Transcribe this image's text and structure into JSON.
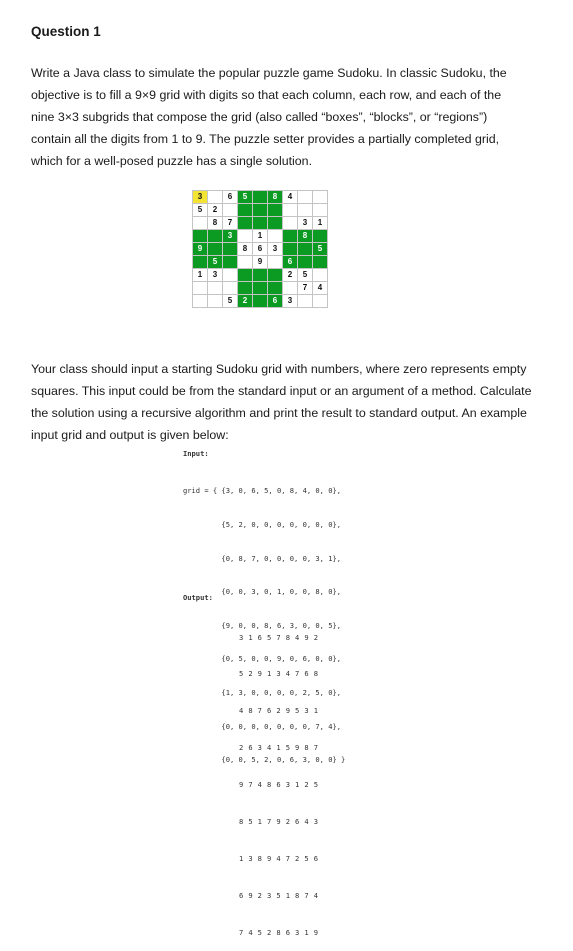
{
  "heading": "Question 1",
  "paragraph1": [
    "Write a Java class to simulate the popular puzzle game Sudoku. In classic Sudoku, the",
    "objective is to fill a 9×9 grid with digits so that each column, each row, and each of the",
    "nine 3×3 subgrids that compose the grid (also called “boxes”, “blocks”, or “regions”)",
    "contain all the digits from 1 to 9. The puzzle setter provides a partially completed grid,",
    "which for a well-posed puzzle has a single solution."
  ],
  "puzzle": [
    [
      "3",
      "",
      "6",
      "5",
      "",
      "8",
      "4",
      "",
      ""
    ],
    [
      "5",
      "2",
      "",
      "",
      "",
      "",
      "",
      "",
      ""
    ],
    [
      "",
      "8",
      "7",
      "",
      "",
      "",
      "",
      "3",
      "1"
    ],
    [
      "",
      "",
      "3",
      "",
      "1",
      "",
      "",
      "8",
      ""
    ],
    [
      "9",
      "",
      "",
      "8",
      "6",
      "3",
      "",
      "",
      "5"
    ],
    [
      "",
      "5",
      "",
      "",
      "9",
      "",
      "6",
      "",
      ""
    ],
    [
      "1",
      "3",
      "",
      "",
      "",
      "",
      "2",
      "5",
      ""
    ],
    [
      "",
      "",
      "",
      "",
      "",
      "",
      "",
      "7",
      "4"
    ],
    [
      "",
      "",
      "5",
      "2",
      "",
      "6",
      "3",
      "",
      ""
    ]
  ],
  "colors": {
    "box_green": "#0b9a22",
    "highlight_yellow": "#f3e332"
  },
  "paragraph2": [
    "Your class should input a starting Sudoku grid with numbers, where zero represents empty",
    "squares. This input could be from the standard input or an argument of a method. Calculate",
    "the solution using a recursive algorithm and print the result to standard output. An example",
    "input grid and output is given below:"
  ],
  "input_label": "Input:",
  "input_code": [
    "grid = { {3, 0, 6, 5, 0, 8, 4, 0, 0},",
    "         {5, 2, 0, 0, 0, 0, 0, 0, 0},",
    "         {0, 8, 7, 0, 0, 0, 0, 3, 1},",
    "         {0, 0, 3, 0, 1, 0, 0, 8, 0},",
    "         {9, 0, 0, 8, 6, 3, 0, 0, 5},",
    "         {0, 5, 0, 0, 9, 0, 6, 0, 0},",
    "         {1, 3, 0, 0, 0, 0, 2, 5, 0},",
    "         {0, 0, 0, 0, 0, 0, 0, 7, 4},",
    "         {0, 0, 5, 2, 0, 6, 3, 0, 0} }"
  ],
  "output_label": "Output:",
  "output_lines": [
    "3 1 6 5 7 8 4 9 2",
    "5 2 9 1 3 4 7 6 8",
    "4 8 7 6 2 9 5 3 1",
    "2 6 3 4 1 5 9 8 7",
    "9 7 4 8 6 3 1 2 5",
    "8 5 1 7 9 2 6 4 3",
    "1 3 8 9 4 7 2 5 6",
    "6 9 2 3 5 1 8 7 4",
    "7 4 5 2 8 6 3 1 9"
  ]
}
